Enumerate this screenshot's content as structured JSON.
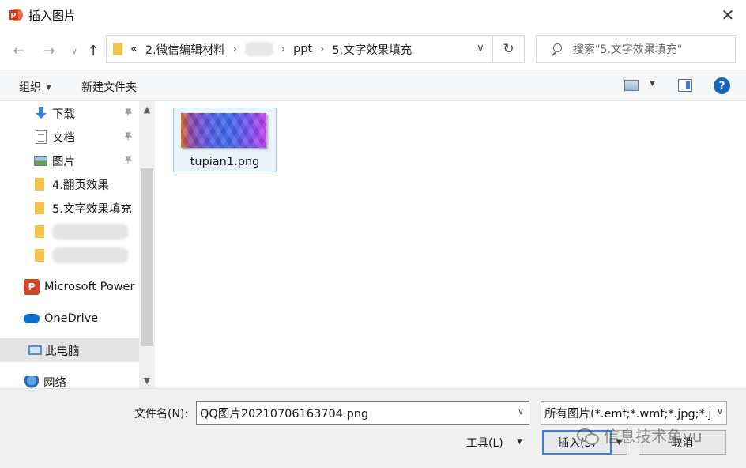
{
  "window": {
    "title": "插入图片",
    "app_icon_letter": "P",
    "close_glyph": "✕"
  },
  "nav": {
    "back_glyph": "←",
    "forward_glyph": "→",
    "recent_glyph": "∨",
    "up_glyph": "↑",
    "refresh_glyph": "↻",
    "breadcrumb_prefix": "«",
    "breadcrumbs": [
      "2.微信编辑材料",
      "",
      "ppt",
      "5.文字效果填充"
    ],
    "separator": "›",
    "dropdown_glyph": "∨",
    "search_placeholder": "搜索\"5.文字效果填充\""
  },
  "toolbar": {
    "organize_label": "组织",
    "new_folder_label": "新建文件夹",
    "help_label": "?"
  },
  "sidebar": {
    "quick": [
      {
        "label": "下载",
        "icon": "download-icon",
        "pinned": true
      },
      {
        "label": "文档",
        "icon": "document-icon",
        "pinned": true
      },
      {
        "label": "图片",
        "icon": "pictures-icon",
        "pinned": true
      },
      {
        "label": "4.翻页效果",
        "icon": "folder-icon",
        "pinned": false
      },
      {
        "label": "5.文字效果填充",
        "icon": "folder-icon",
        "pinned": false
      }
    ],
    "pin_glyph": "📌",
    "apps": [
      {
        "label": "Microsoft Power",
        "icon": "powerpoint-icon"
      },
      {
        "label": "OneDrive",
        "icon": "onedrive-icon"
      },
      {
        "label": "此电脑",
        "icon": "this-pc-icon",
        "selected": true
      },
      {
        "label": "网络",
        "icon": "network-icon"
      }
    ],
    "scroll_up_glyph": "▲",
    "scroll_down_glyph": "▼"
  },
  "files": [
    {
      "name": "tupian1.png",
      "selected": true
    }
  ],
  "footer": {
    "filename_label": "文件名(N):",
    "filename_value": "QQ图片20210706163704.png",
    "filter_value": "所有图片(*.emf;*.wmf;*.jpg;*.j",
    "tools_label": "工具(L)",
    "insert_label": "插入(S)",
    "cancel_label": "取消",
    "caret_glyph": "∨",
    "small_caret_glyph": "▼"
  },
  "watermark": {
    "text": "信息技术鱼yu"
  }
}
